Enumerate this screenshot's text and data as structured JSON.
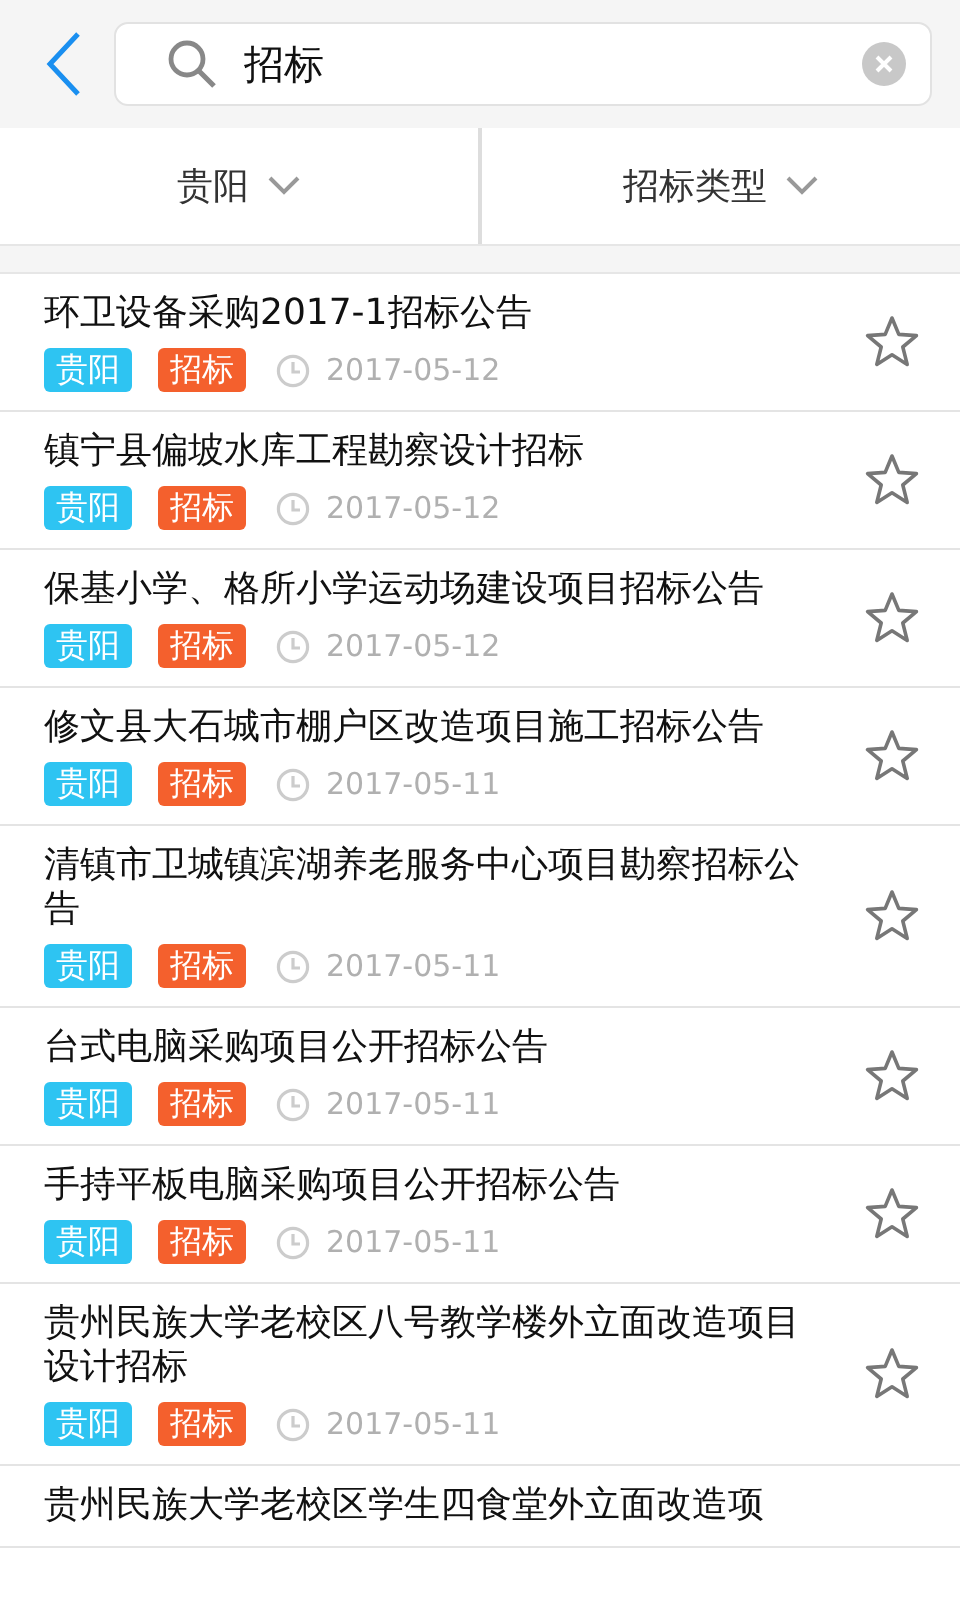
{
  "search": {
    "value": "招标"
  },
  "filters": [
    {
      "label": "贵阳"
    },
    {
      "label": "招标类型"
    }
  ],
  "items": [
    {
      "title": "环卫设备采购2017-1招标公告",
      "region": "贵阳",
      "type": "招标",
      "date": "2017-05-12",
      "starred": false
    },
    {
      "title": "镇宁县偏坡水库工程勘察设计招标",
      "region": "贵阳",
      "type": "招标",
      "date": "2017-05-12",
      "starred": false
    },
    {
      "title": "保基小学、格所小学运动场建设项目招标公告",
      "region": "贵阳",
      "type": "招标",
      "date": "2017-05-12",
      "starred": false
    },
    {
      "title": "修文县大石城市棚户区改造项目施工招标公告",
      "region": "贵阳",
      "type": "招标",
      "date": "2017-05-11",
      "starred": false
    },
    {
      "title": "清镇市卫城镇滨湖养老服务中心项目勘察招标公告",
      "region": "贵阳",
      "type": "招标",
      "date": "2017-05-11",
      "starred": false
    },
    {
      "title": "台式电脑采购项目公开招标公告",
      "region": "贵阳",
      "type": "招标",
      "date": "2017-05-11",
      "starred": false
    },
    {
      "title": "手持平板电脑采购项目公开招标公告",
      "region": "贵阳",
      "type": "招标",
      "date": "2017-05-11",
      "starred": false
    },
    {
      "title": "贵州民族大学老校区八号教学楼外立面改造项目设计招标",
      "region": "贵阳",
      "type": "招标",
      "date": "2017-05-11",
      "starred": false
    },
    {
      "title": "贵州民族大学老校区学生四食堂外立面改造项"
    }
  ]
}
